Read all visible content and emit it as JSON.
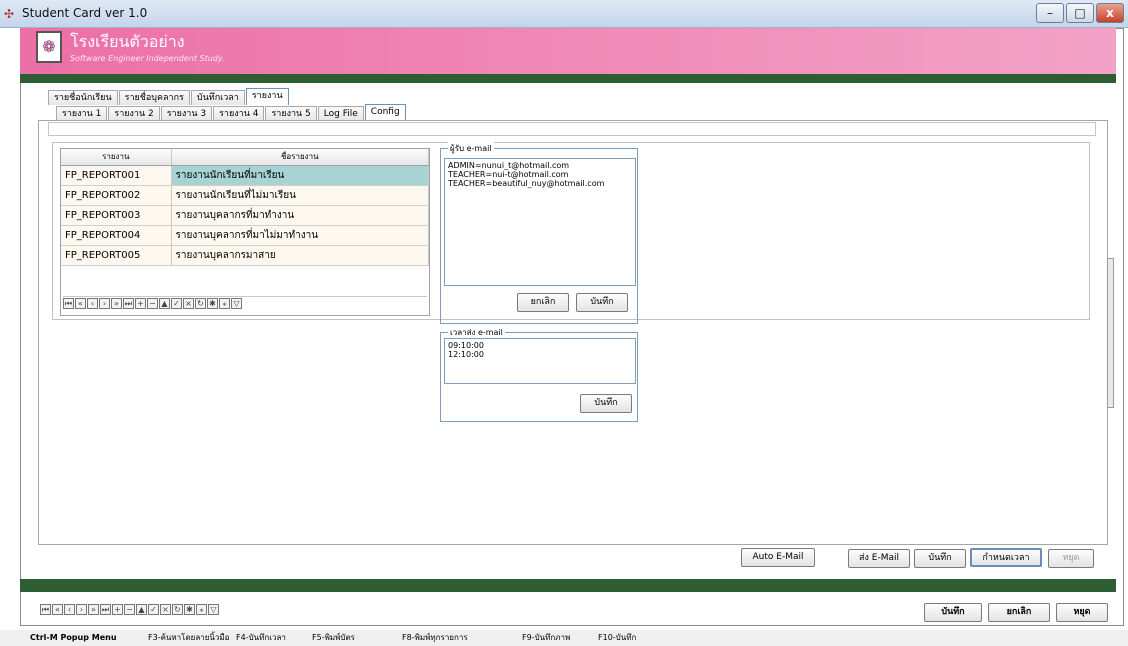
{
  "window": {
    "title": "Student Card ver 1.0",
    "minimize": "–",
    "maximize": "□",
    "close": "x"
  },
  "header": {
    "school_name": "โรงเรียนตัวอย่าง",
    "subtitle": "Software Engineer Independent Study."
  },
  "main_tabs": [
    "รายชื่อนักเรียน",
    "รายชื่อบุคลากร",
    "บันทึกเวลา",
    "รายงาน"
  ],
  "main_tab_active": 3,
  "sub_tabs": [
    "รายงาน 1",
    "รายงาน 2",
    "รายงาน 3",
    "รายงาน 4",
    "รายงาน 5",
    "Log File",
    "Config"
  ],
  "sub_tab_active": 6,
  "report_grid": {
    "columns": [
      "รายงาน",
      "ชื่อรายงาน"
    ],
    "rows": [
      {
        "code": "FP_REPORT001",
        "name": "รายงานนักเรียนที่มาเรียน"
      },
      {
        "code": "FP_REPORT002",
        "name": "รายงานนักเรียนที่ไม่มาเรียน"
      },
      {
        "code": "FP_REPORT003",
        "name": "รายงานบุคลากรที่มาทำงาน"
      },
      {
        "code": "FP_REPORT004",
        "name": "รายงานบุคลากรที่มาไม่มาทำงาน"
      },
      {
        "code": "FP_REPORT005",
        "name": "รายงานบุคลากรมาสาย"
      }
    ],
    "selected_row": 0
  },
  "email_recipients": {
    "label": "ผู้รับ e-mail",
    "lines": [
      "ADMIN=nunui_t@hotmail.com",
      "TEACHER=nui-t@hotmail.com",
      "TEACHER=beautiful_nuy@hotmail.com"
    ],
    "cancel_label": "ยกเลิก",
    "save_label": "บันทึก"
  },
  "send_times": {
    "label": "เวลาส่ง e-mail",
    "lines": [
      "09:10:00",
      "12:10:00"
    ],
    "save_label": "บันทึก"
  },
  "bottom_actions": {
    "auto_email": "Auto E-Mail",
    "send_email": "ส่ง E-Mail",
    "save": "บันทึก",
    "set_time": "กำหนดเวลา",
    "stop": "หยุด"
  },
  "footer_actions": {
    "save": "บันทึก",
    "cancel": "ยกเลิก",
    "stop": "หยุด"
  },
  "status_bar": [
    "Ctrl-M  Popup Menu",
    "F3-ค้นหาโดยลายนิ้วมือ",
    "F4-บันทึกเวลา",
    "F5-พิมพ์บัตร",
    "F8-พิมพ์ทุกรายการ",
    "F9-บันทึกภาพ",
    "F10-บันทึก"
  ],
  "colors": {
    "banner": "#ec6fa6",
    "green_bar": "#2f5d33",
    "selected_row": "#a7d3d3",
    "row_bg": "#fdf8ef"
  }
}
